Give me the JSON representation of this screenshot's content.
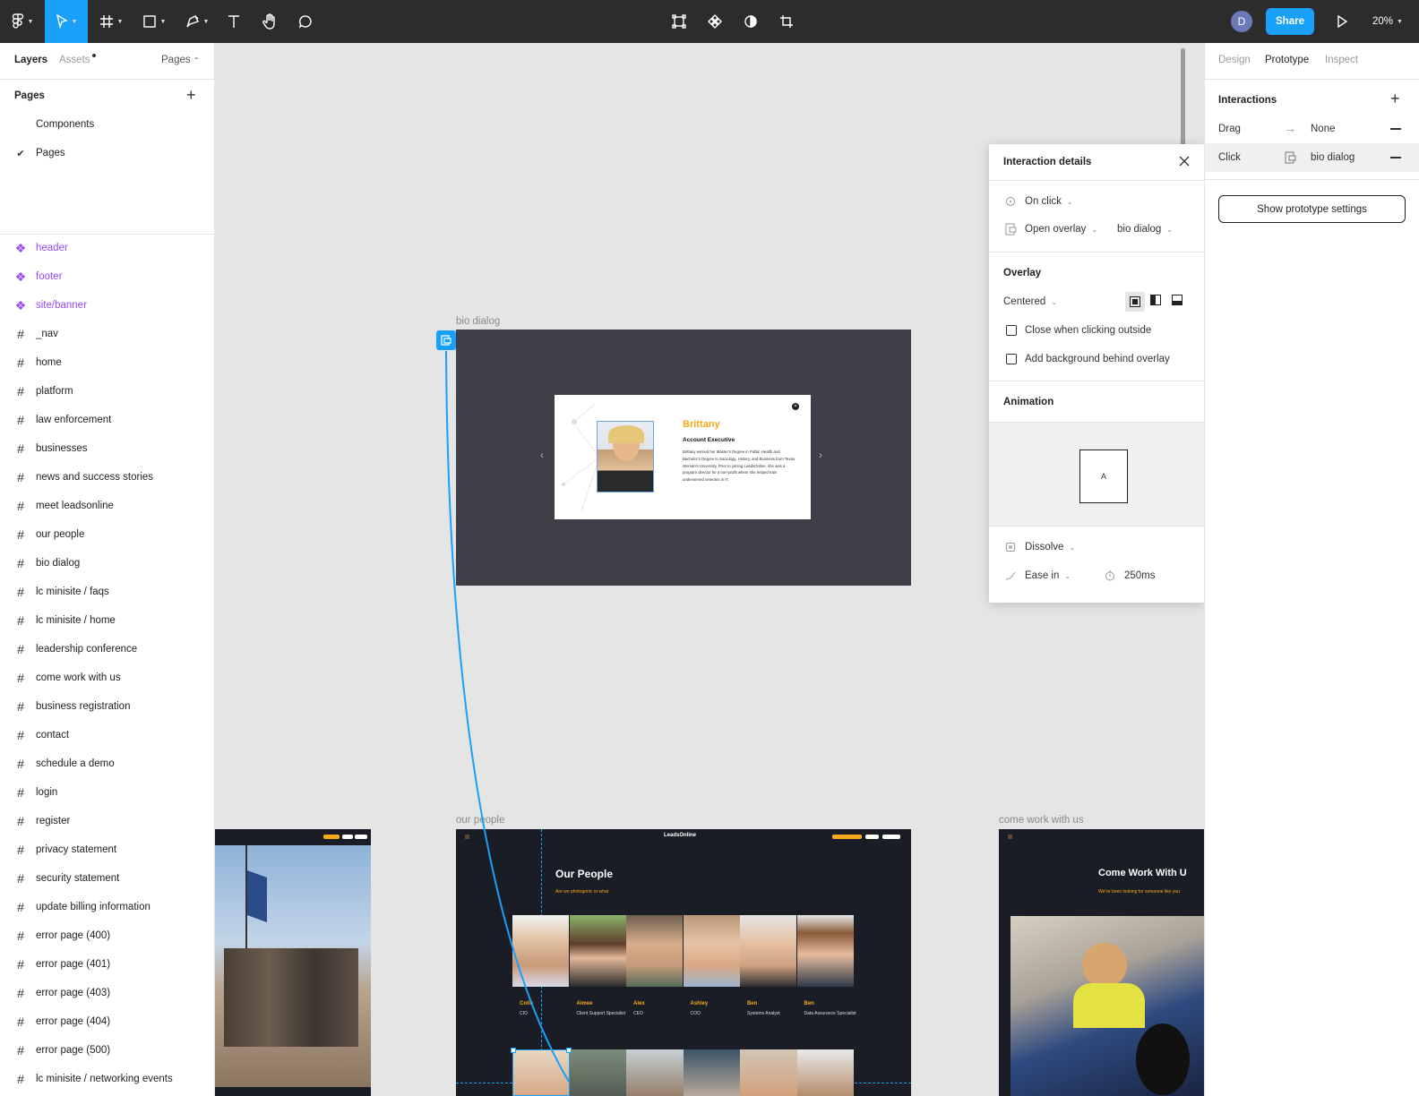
{
  "toolbar": {
    "share_label": "Share",
    "zoom_label": "20%",
    "avatar_initial": "D"
  },
  "left_panel": {
    "tabs": {
      "layers": "Layers",
      "assets": "Assets",
      "pages": "Pages"
    },
    "pages_header": "Pages",
    "pages": [
      {
        "label": "Components",
        "checked": false
      },
      {
        "label": "Pages",
        "checked": true
      }
    ],
    "layers": [
      {
        "label": "header",
        "type": "component"
      },
      {
        "label": "footer",
        "type": "component"
      },
      {
        "label": "site/banner",
        "type": "component"
      },
      {
        "label": "_nav",
        "type": "frame"
      },
      {
        "label": "home",
        "type": "frame"
      },
      {
        "label": "platform",
        "type": "frame"
      },
      {
        "label": "law enforcement",
        "type": "frame"
      },
      {
        "label": "businesses",
        "type": "frame"
      },
      {
        "label": "news and success stories",
        "type": "frame"
      },
      {
        "label": "meet leadsonline",
        "type": "frame"
      },
      {
        "label": "our people",
        "type": "frame"
      },
      {
        "label": "bio dialog",
        "type": "frame"
      },
      {
        "label": "lc minisite / faqs",
        "type": "frame"
      },
      {
        "label": "lc minisite / home",
        "type": "frame"
      },
      {
        "label": "leadership conference",
        "type": "frame"
      },
      {
        "label": "come work with us",
        "type": "frame"
      },
      {
        "label": "business registration",
        "type": "frame"
      },
      {
        "label": "contact",
        "type": "frame"
      },
      {
        "label": "schedule a demo",
        "type": "frame"
      },
      {
        "label": "login",
        "type": "frame"
      },
      {
        "label": "register",
        "type": "frame"
      },
      {
        "label": "privacy statement",
        "type": "frame"
      },
      {
        "label": "security statement",
        "type": "frame"
      },
      {
        "label": "update billing information",
        "type": "frame"
      },
      {
        "label": "error page (400)",
        "type": "frame"
      },
      {
        "label": "error page (401)",
        "type": "frame"
      },
      {
        "label": "error page (403)",
        "type": "frame"
      },
      {
        "label": "error page (404)",
        "type": "frame"
      },
      {
        "label": "error page (500)",
        "type": "frame"
      },
      {
        "label": "lc minisite / networking events",
        "type": "frame"
      }
    ]
  },
  "canvas": {
    "bio_dialog_label": "bio dialog",
    "our_people_label": "our people",
    "come_work_label": "come work with us",
    "bio": {
      "name": "Brittany",
      "title": "Account Executive",
      "text": "Brittany earned her Master's Degree in Public Health and Bachelor's Degree in Sociology, History, and Business from Texas Woman's University. Prior to joining LeadsOnline, she was a program director for a non-profit where she helped train underserved veterans in IT."
    },
    "our_people": {
      "logo": "LeadsOnline",
      "title": "Our People",
      "subtitle": "Are we photogenic or what",
      "people": [
        {
          "name": "Colin",
          "role": "CIO"
        },
        {
          "name": "Aimee",
          "role": "Client Support Specialist"
        },
        {
          "name": "Alex",
          "role": "CEO"
        },
        {
          "name": "Ashley",
          "role": "COO"
        },
        {
          "name": "Ben",
          "role": "Systems Analyst"
        },
        {
          "name": "Ben",
          "role": "Data Assurance Specialist"
        }
      ]
    },
    "come_work": {
      "title": "Come Work With U",
      "subtitle": "We've been looking for someone like you"
    },
    "help": "?"
  },
  "right_panel": {
    "tabs": {
      "design": "Design",
      "prototype": "Prototype",
      "inspect": "Inspect"
    },
    "interactions_title": "Interactions",
    "interactions": [
      {
        "trigger": "Drag",
        "target": "None"
      },
      {
        "trigger": "Click",
        "target": "bio dialog"
      }
    ],
    "show_settings": "Show prototype settings"
  },
  "interaction_details": {
    "title": "Interaction details",
    "trigger": "On click",
    "action": "Open overlay",
    "destination": "bio dialog",
    "overlay_title": "Overlay",
    "position": "Centered",
    "close_outside": "Close when clicking outside",
    "add_background": "Add background behind overlay",
    "animation_title": "Animation",
    "preview_letter": "A",
    "animation_type": "Dissolve",
    "easing": "Ease in",
    "duration": "250ms"
  }
}
